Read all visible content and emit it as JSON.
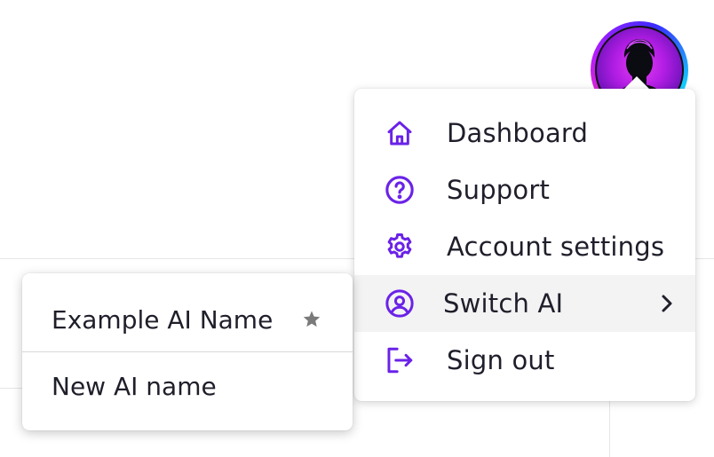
{
  "colors": {
    "accent": "#6a22e8",
    "text": "#1f1f2b",
    "star": "#7a7a7a"
  },
  "avatar": {
    "icon": "user-avatar-icon"
  },
  "menu": {
    "items": [
      {
        "label": "Dashboard",
        "icon": "home-icon"
      },
      {
        "label": "Support",
        "icon": "help-circle-icon"
      },
      {
        "label": "Account settings",
        "icon": "gear-icon"
      },
      {
        "label": "Switch AI",
        "icon": "user-circle-icon",
        "active": true,
        "has_submenu": true
      },
      {
        "label": "Sign out",
        "icon": "sign-out-icon"
      }
    ]
  },
  "submenu": {
    "items": [
      {
        "label": "Example AI Name",
        "starred": true
      },
      {
        "label": "New AI name"
      }
    ]
  }
}
